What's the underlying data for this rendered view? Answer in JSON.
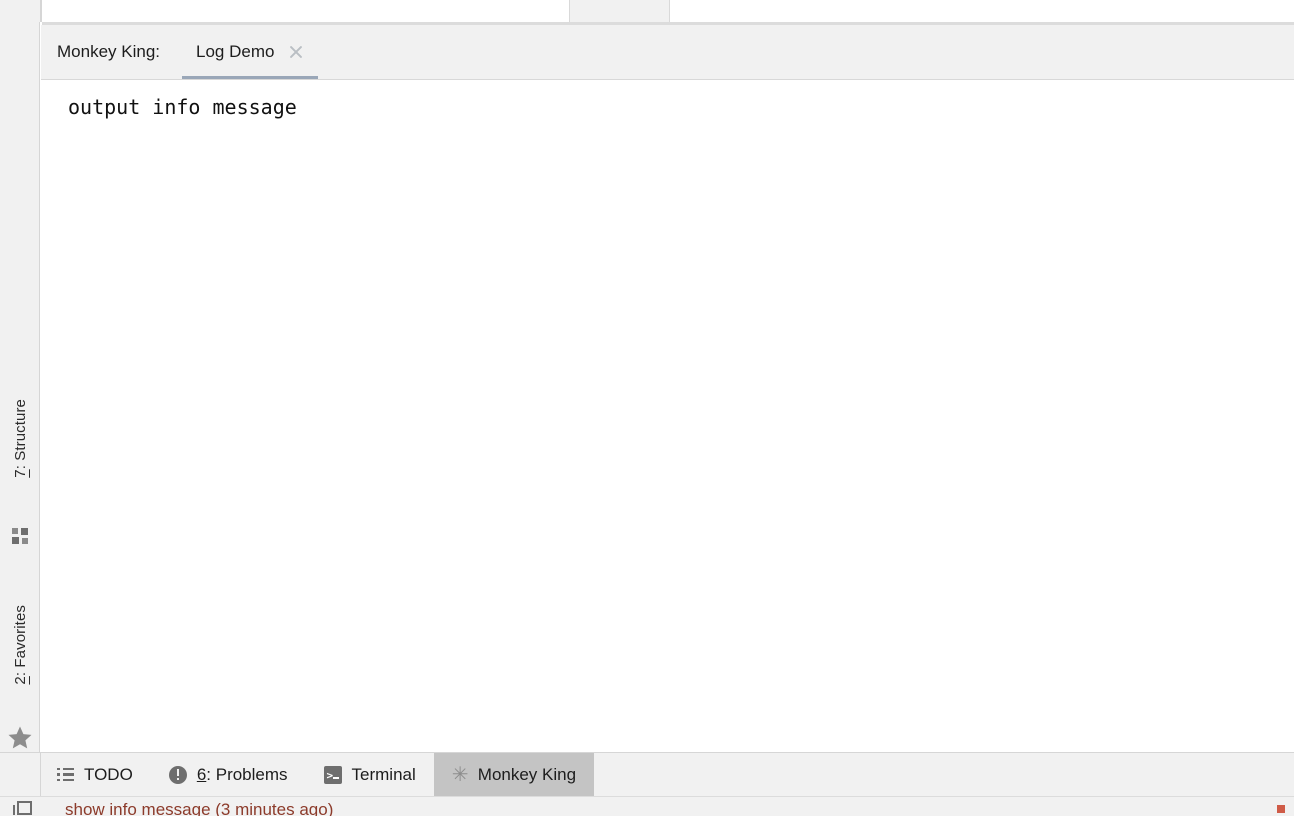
{
  "window": {
    "theme_background": "#ffffff",
    "panel_background": "#f1f1f1",
    "selected_tab_background": "#c4c4c4",
    "tab_indicator_color": "#9aa7b8",
    "status_text_color": "#8c3b2b"
  },
  "left_tool_strip": {
    "items": [
      {
        "id": "structure",
        "shortcut": "7",
        "label_prefix": "7",
        "label": "7: Structure",
        "icon": "structure-icon"
      },
      {
        "id": "favorites",
        "shortcut": "2",
        "label_prefix": "2",
        "label": "2: Favorites",
        "icon": "star-icon",
        "icon_glyph": "★"
      }
    ]
  },
  "console": {
    "runner_label": "Monkey King:",
    "tabs": [
      {
        "label": "Log Demo",
        "active": true,
        "close_icon": "close-icon"
      }
    ],
    "output_lines": [
      "output info message"
    ]
  },
  "bottom_tool_bar": {
    "tabs": [
      {
        "id": "todo",
        "label": "TODO",
        "icon": "todo-list-icon",
        "selected": false
      },
      {
        "id": "problems",
        "label_number": "6",
        "label_rest": ": Problems",
        "label": "6: Problems",
        "icon": "problems-warning-icon",
        "selected": false
      },
      {
        "id": "terminal",
        "label": "Terminal",
        "icon": "terminal-icon",
        "selected": false
      },
      {
        "id": "monkey-king",
        "label": "Monkey King",
        "icon": "asterisk-icon",
        "icon_glyph": "✳",
        "selected": true
      }
    ]
  },
  "status_bar": {
    "icon": "checkbox-icon",
    "message": "show info message (3 minutes ago)"
  }
}
